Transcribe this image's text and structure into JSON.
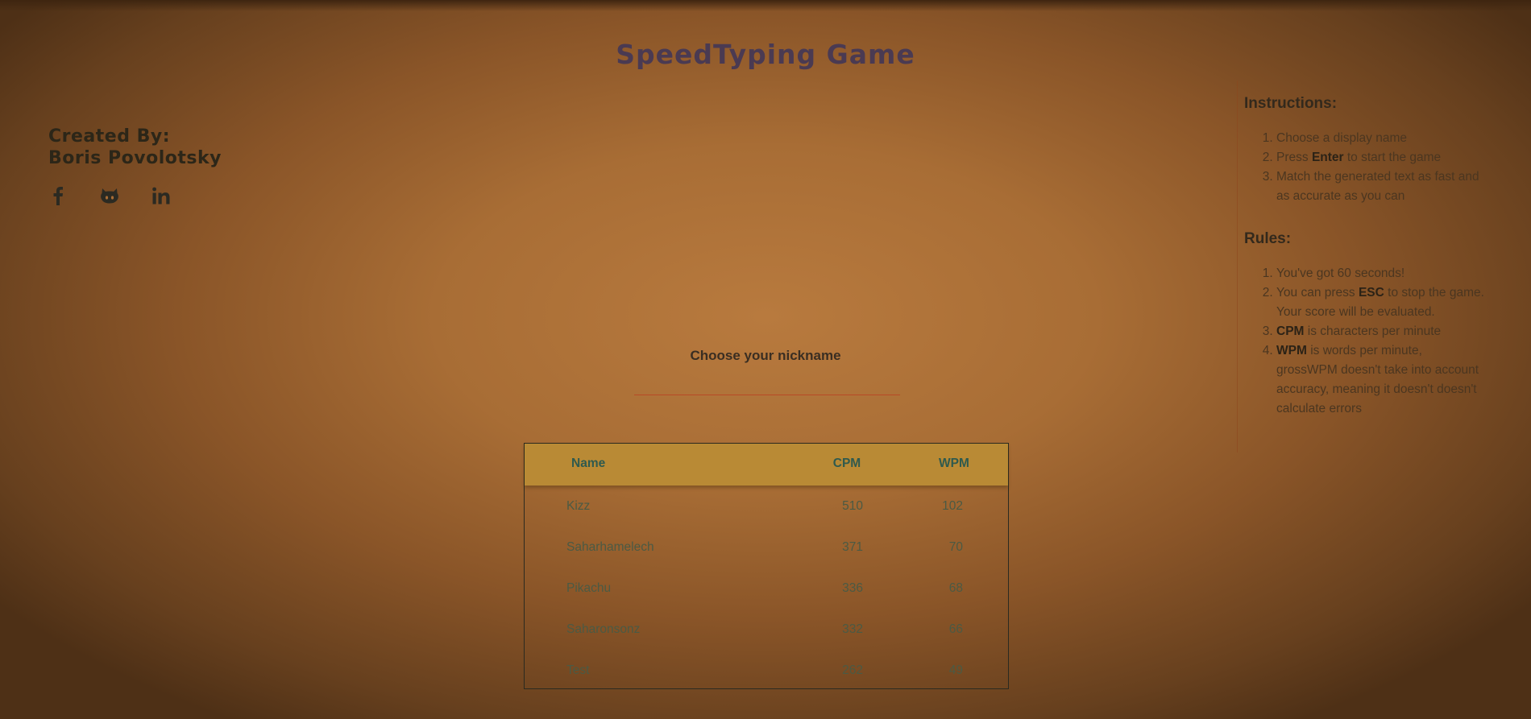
{
  "app": {
    "title": "SpeedTyping Game"
  },
  "author": {
    "line1": "Created By:",
    "line2": "Boris Povolotsky"
  },
  "socials": [
    {
      "icon": "facebook-icon"
    },
    {
      "icon": "github-icon"
    },
    {
      "icon": "linkedin-icon"
    }
  ],
  "instructions": {
    "heading": "Instructions:",
    "items": [
      {
        "pre": "Choose a display name",
        "bold": "",
        "post": ""
      },
      {
        "pre": "Press ",
        "bold": "Enter",
        "post": " to start the game"
      },
      {
        "pre": "Match the generated text as fast and as accurate as you can",
        "bold": "",
        "post": ""
      }
    ]
  },
  "rules": {
    "heading": "Rules:",
    "items": [
      {
        "pre": "You've got 60 seconds!",
        "bold": "",
        "post": ""
      },
      {
        "pre": "You can press ",
        "bold": "ESC",
        "post": " to stop the game. Your score will be evaluated."
      },
      {
        "pre": "",
        "bold": "CPM",
        "post": " is characters per minute"
      },
      {
        "pre": "",
        "bold": "WPM",
        "post": " is words per minute, grossWPM doesn't take into account accuracy, meaning it doesn't doesn't calculate errors"
      }
    ]
  },
  "nickname": {
    "label": "Choose your nickname",
    "value": "",
    "placeholder": ""
  },
  "leaderboard": {
    "columns": [
      "Name",
      "CPM",
      "WPM"
    ],
    "rows": [
      {
        "name": "Kizz",
        "cpm": "510",
        "wpm": "102"
      },
      {
        "name": "Saharhamelech",
        "cpm": "371",
        "wpm": "70"
      },
      {
        "name": "Pikachu",
        "cpm": "336",
        "wpm": "68"
      },
      {
        "name": "Saharonsonz",
        "cpm": "332",
        "wpm": "66"
      },
      {
        "name": "Test",
        "cpm": "262",
        "wpm": "49"
      }
    ]
  },
  "colors": {
    "background": "#b07838",
    "title": "#4a3a52",
    "table_header": "#b98a35",
    "table_header_text": "#2f5a4e",
    "input_underline": "#b84a26"
  }
}
